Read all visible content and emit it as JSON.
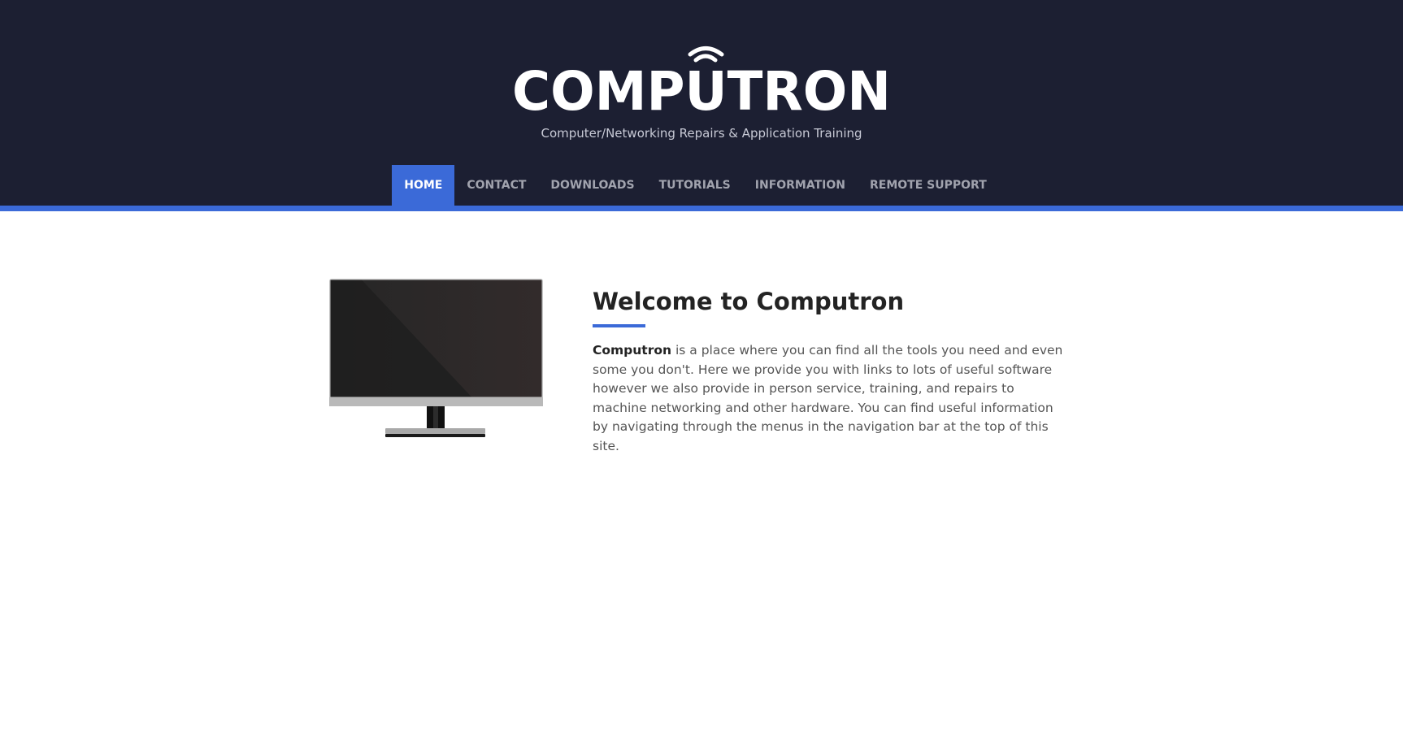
{
  "brand": {
    "logo_text": "COMPUTRON",
    "tagline": "Computer/Networking Repairs & Application Training"
  },
  "nav": {
    "items": [
      {
        "label": "HOME",
        "active": true
      },
      {
        "label": "CONTACT",
        "active": false
      },
      {
        "label": "DOWNLOADS",
        "active": false
      },
      {
        "label": "TUTORIALS",
        "active": false
      },
      {
        "label": "INFORMATION",
        "active": false
      },
      {
        "label": "REMOTE SUPPORT",
        "active": false
      }
    ]
  },
  "main": {
    "title": "Welcome to Computron",
    "intro_bold": "Computron",
    "intro_text": " is a place where you can find all the tools you need and even some you don't. Here we provide you with links to lots of useful software however we also provide in person service, training, and repairs to machine networking and other hardware. You can find useful information by navigating through the menus in the navigation bar at the top of this site."
  },
  "colors": {
    "header_bg": "#1c1f32",
    "accent": "#3b6ad8",
    "nav_text": "#a1a3ae",
    "body_text": "#555555",
    "heading_text": "#232323"
  },
  "icons": {
    "logo": "computron-wifi-logo",
    "hero": "desktop-monitor-icon"
  }
}
